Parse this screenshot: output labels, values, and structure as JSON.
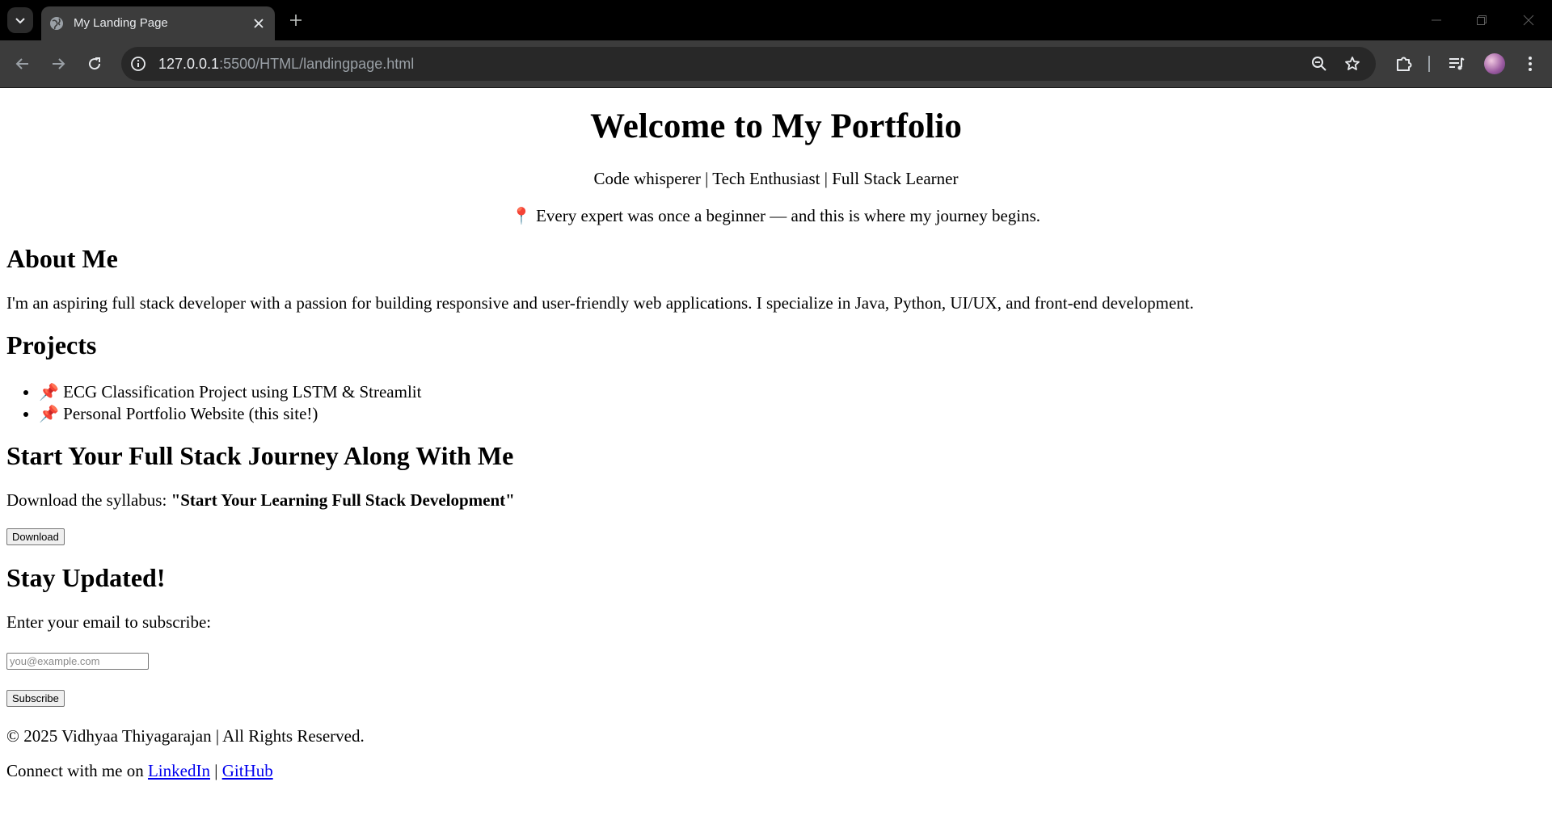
{
  "browser": {
    "tab_title": "My Landing Page",
    "url_host": "127.0.0.1",
    "url_rest": ":5500/HTML/landingpage.html"
  },
  "page": {
    "heading": "Welcome to My Portfolio",
    "tagline": "Code whisperer | Tech Enthusiast | Full Stack Learner",
    "quote_icon": "📍",
    "quote": "Every expert was once a beginner — and this is where my journey begins.",
    "about": {
      "heading": "About Me",
      "text": "I'm an aspiring full stack developer with a passion for building responsive and user-friendly web applications. I specialize in Java, Python, UI/UX, and front-end development."
    },
    "projects": {
      "heading": "Projects",
      "items": [
        {
          "icon": "📌",
          "label": "ECG Classification Project using LSTM & Streamlit"
        },
        {
          "icon": "📌",
          "label": "Personal Portfolio Website (this site!)"
        }
      ]
    },
    "journey": {
      "heading": "Start Your Full Stack Journey Along With Me",
      "prefix": "Download the syllabus: ",
      "syllabus_title": "\"Start Your Learning Full Stack Development\"",
      "download_label": "Download"
    },
    "subscribe": {
      "heading": "Stay Updated!",
      "prompt": "Enter your email to subscribe:",
      "placeholder": "you@example.com",
      "button_label": "Subscribe"
    },
    "footer": {
      "copyright": "© 2025 Vidhyaa Thiyagarajan | All Rights Reserved.",
      "connect_prefix": "Connect with me on ",
      "linkedin": "LinkedIn",
      "separator": " | ",
      "github": "GitHub"
    }
  }
}
